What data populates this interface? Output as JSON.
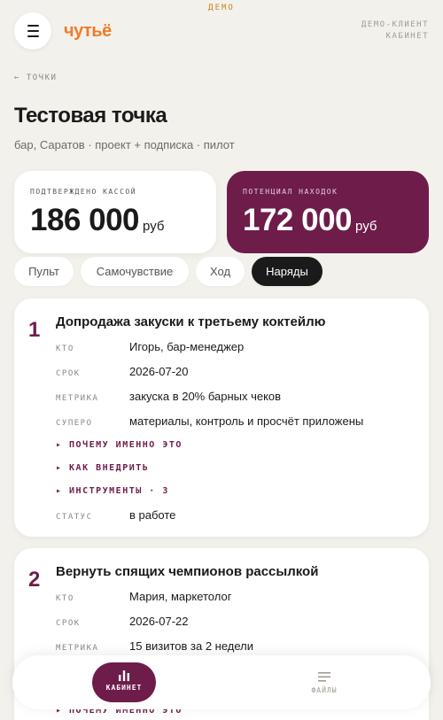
{
  "demo_tag": "ДЕМО",
  "header": {
    "logo": "чутьё",
    "client_line1": "ДЕМО-КЛИЕНТ",
    "client_line2": "КАБИНЕТ"
  },
  "breadcrumb": "← ТОЧКИ",
  "page": {
    "title": "Тестовая точка",
    "subtitle": "бар, Саратов · проект + подписка · пилот"
  },
  "stats": [
    {
      "label": "ПОДТВЕРЖДЕНО КАССОЙ",
      "value": "186 000",
      "unit": "руб"
    },
    {
      "label": "ПОТЕНЦИАЛ НАХОДОК",
      "value": "172 000",
      "unit": "руб"
    }
  ],
  "tabs": [
    {
      "label": "Пульт"
    },
    {
      "label": "Самочувствие"
    },
    {
      "label": "Ход"
    },
    {
      "label": "Наряды",
      "active": true
    }
  ],
  "orders": [
    {
      "num": "1",
      "title": "Допродажа закуски к третьему коктейлю",
      "fields": [
        {
          "k": "КТО",
          "v": "Игорь, бар-менеджер"
        },
        {
          "k": "СРОК",
          "v": "2026-07-20"
        },
        {
          "k": "МЕТРИКА",
          "v": "закуска в 20% барных чеков"
        },
        {
          "k": "СУПЕРО",
          "v": "материалы, контроль и просчёт приложены"
        }
      ],
      "expanders": [
        "▸ ПОЧЕМУ ИМЕННО ЭТО",
        "▸ КАК ВНЕДРИТЬ",
        "▸ ИНСТРУМЕНТЫ · 3"
      ],
      "status": {
        "k": "СТАТУС",
        "v": "в работе"
      }
    },
    {
      "num": "2",
      "title": "Вернуть спящих чемпионов рассылкой",
      "fields": [
        {
          "k": "КТО",
          "v": "Мария, маркетолог"
        },
        {
          "k": "СРОК",
          "v": "2026-07-22"
        },
        {
          "k": "МЕТРИКА",
          "v": "15 визитов за 2 недели"
        }
      ],
      "expanders": [
        "▸ ПОЧЕМУ ИМЕННО ЭТО"
      ]
    }
  ],
  "bottom_nav": {
    "cabinet": "КАБИНЕТ",
    "files": "ФАЙЛЫ"
  },
  "colors": {
    "accent": "#6e1c4a",
    "logo": "#f07b2a",
    "background": "#f3f1ec"
  },
  "icons": {
    "menu": "hamburger-menu-icon",
    "cabinet": "bar-chart-icon",
    "files": "lines-list-icon"
  }
}
